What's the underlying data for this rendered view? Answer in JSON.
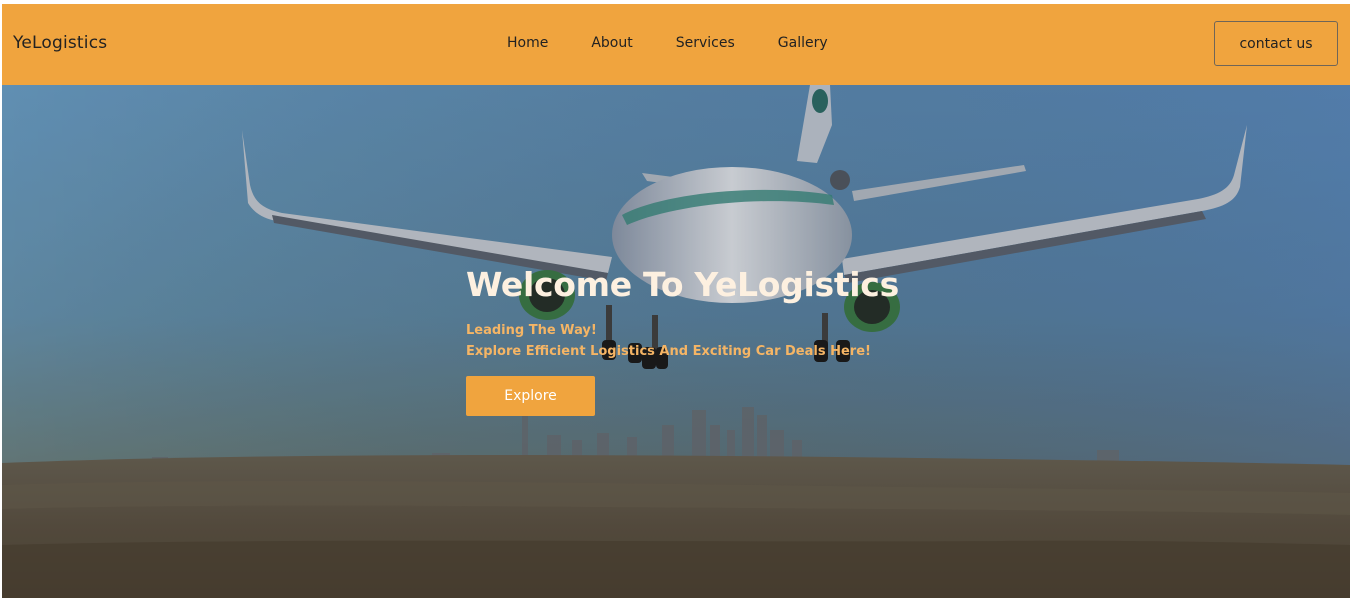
{
  "header": {
    "brand": "YeLogistics",
    "nav": [
      {
        "label": "Home"
      },
      {
        "label": "About"
      },
      {
        "label": "Services"
      },
      {
        "label": "Gallery"
      }
    ],
    "contact_label": "contact us"
  },
  "hero": {
    "title": "Welcome To YeLogistics",
    "tagline": "Leading The Way!",
    "subtitle": "Explore Efficient Logistics And Exciting Car Deals Here!",
    "cta_label": "Explore"
  },
  "colors": {
    "accent": "#f0a43e",
    "title_text": "#fdf0e0",
    "subtitle_text": "#f5b565",
    "sky_top": "#5f8fc4",
    "sky_bottom": "#6e8a8c",
    "ground": "#5b5144"
  },
  "icons": [
    "airplane-image",
    "city-skyline-image"
  ]
}
